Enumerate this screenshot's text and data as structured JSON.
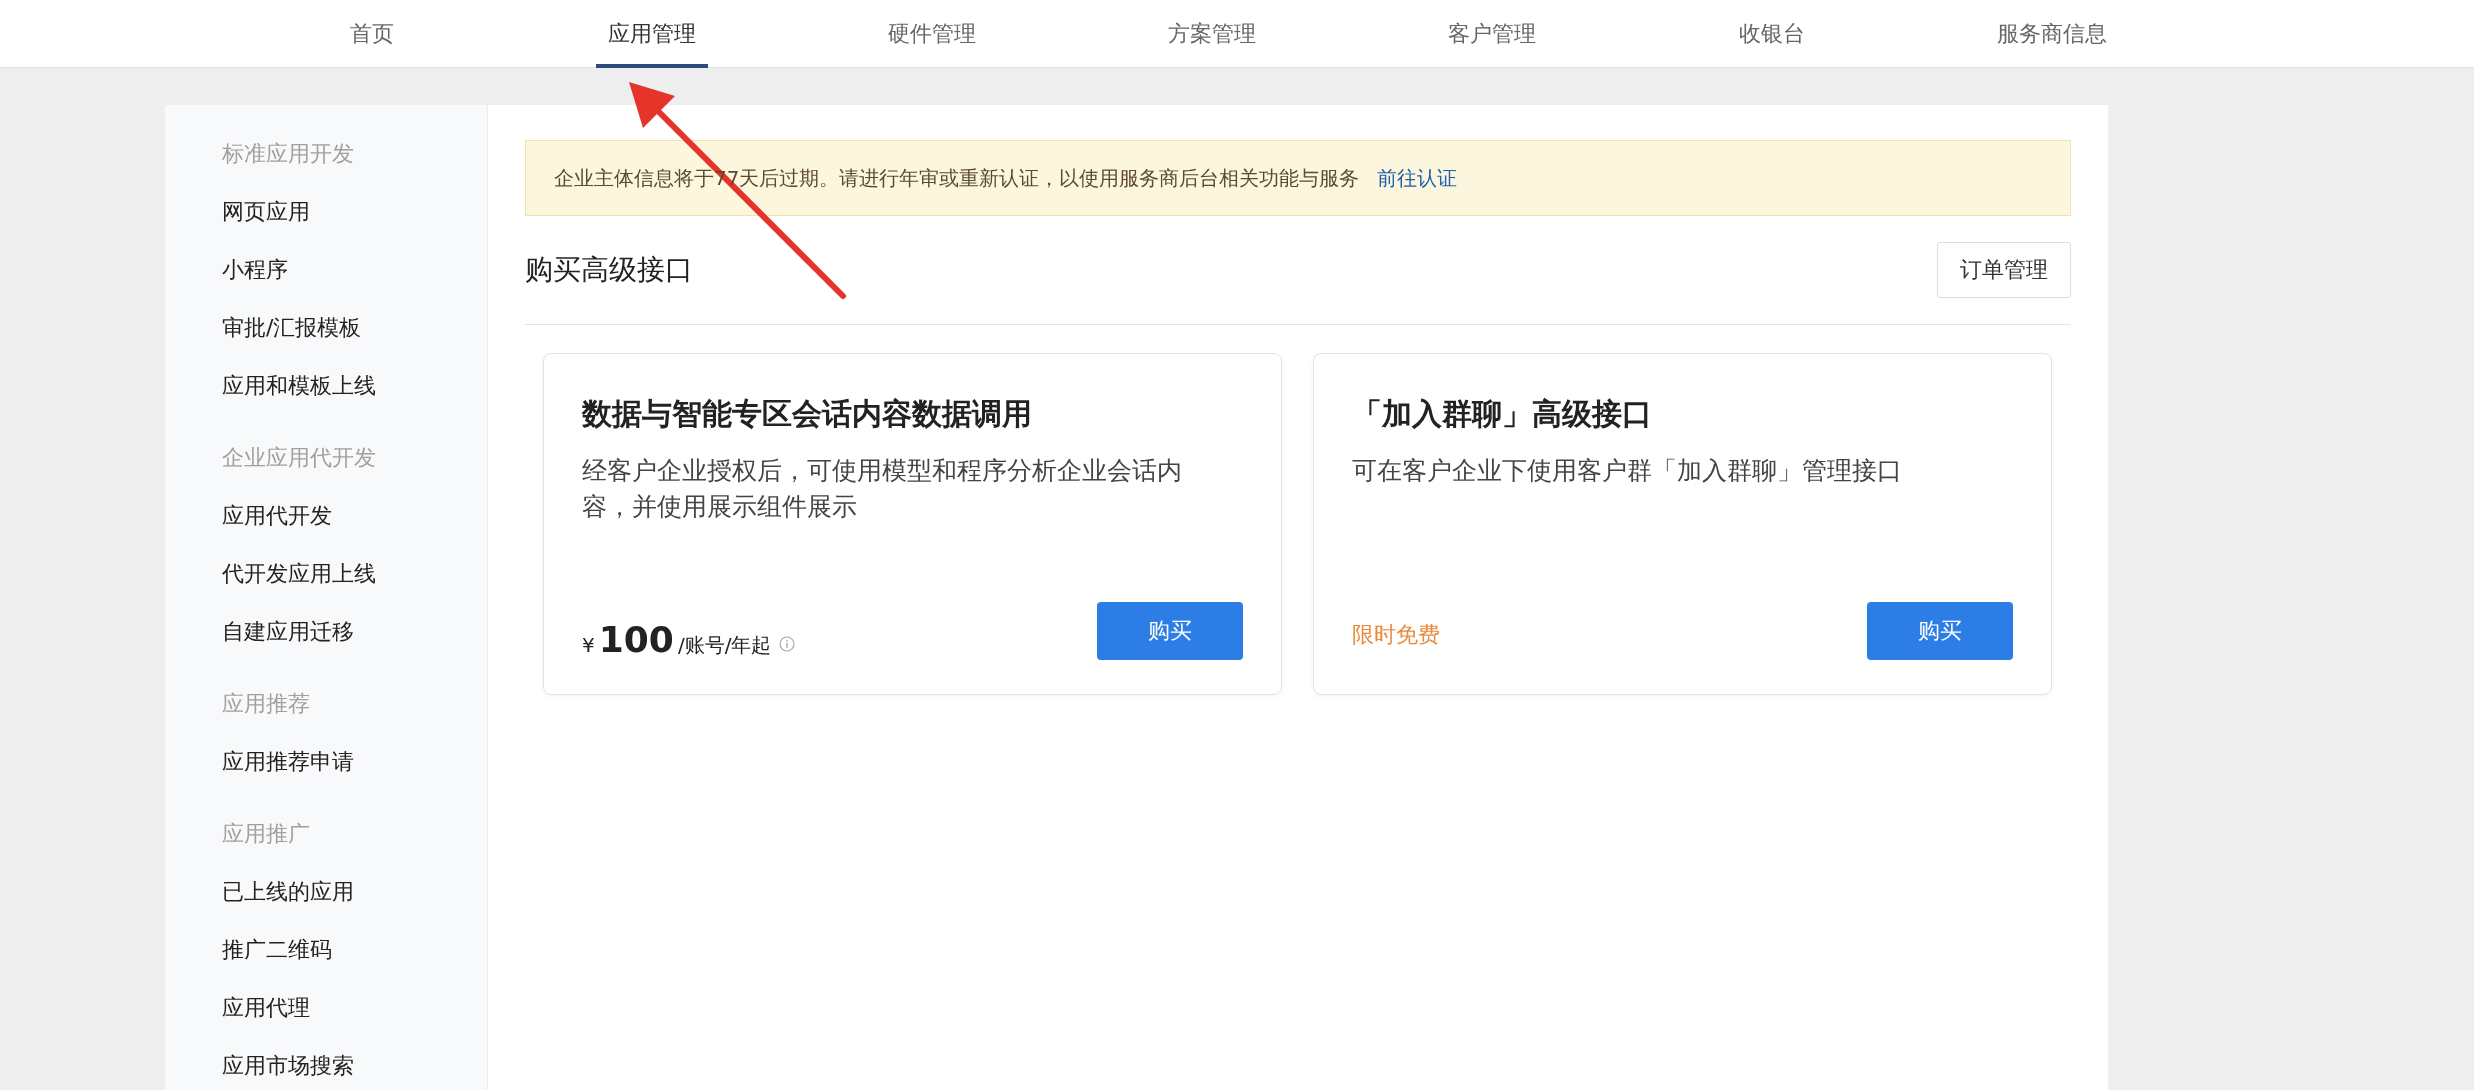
{
  "nav": {
    "items": [
      {
        "label": "首页",
        "selected": false
      },
      {
        "label": "应用管理",
        "selected": true
      },
      {
        "label": "硬件管理",
        "selected": false
      },
      {
        "label": "方案管理",
        "selected": false
      },
      {
        "label": "客户管理",
        "selected": false
      },
      {
        "label": "收银台",
        "selected": false
      },
      {
        "label": "服务商信息",
        "selected": false
      }
    ]
  },
  "sidebar": {
    "groups": [
      {
        "title": "标准应用开发",
        "items": [
          "网页应用",
          "小程序",
          "审批/汇报模板",
          "应用和模板上线"
        ]
      },
      {
        "title": "企业应用代开发",
        "items": [
          "应用代开发",
          "代开发应用上线",
          "自建应用迁移"
        ]
      },
      {
        "title": "应用推荐",
        "items": [
          "应用推荐申请"
        ]
      },
      {
        "title": "应用推广",
        "items": [
          "已上线的应用",
          "推广二维码",
          "应用代理",
          "应用市场搜索"
        ]
      }
    ]
  },
  "notice": {
    "text": "企业主体信息将于77天后过期。请进行年审或重新认证，以使用服务商后台相关功能与服务",
    "link": "前往认证"
  },
  "section": {
    "title": "购买高级接口",
    "button": "订单管理"
  },
  "cards": [
    {
      "kind": "price",
      "title": "数据与智能专区会话内容数据调用",
      "description": "经客户企业授权后，可使用模型和程序分析企业会话内容，并使用展示组件展示",
      "currency": "¥",
      "amount": "100",
      "unit": "/账号/年起",
      "button": "购买"
    },
    {
      "kind": "promo",
      "title": "「加入群聊」高级接口",
      "description": "可在客户企业下使用客户群「加入群聊」管理接口",
      "promo": "限时免费",
      "button": "购买"
    }
  ]
}
